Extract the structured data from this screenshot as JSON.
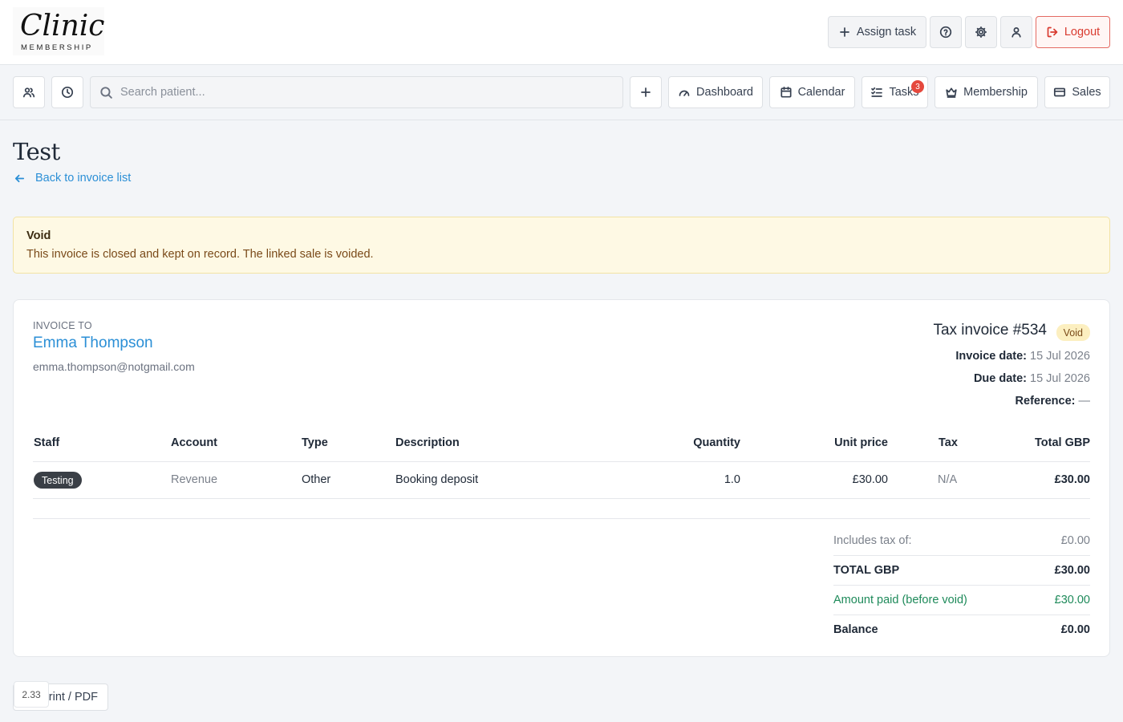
{
  "logo": {
    "script": "Clinic",
    "sub": "MEMBERSHIP"
  },
  "header": {
    "assign_task": "Assign task",
    "logout": "Logout"
  },
  "nav": {
    "search_placeholder": "Search patient...",
    "dashboard": "Dashboard",
    "calendar": "Calendar",
    "tasks": "Tasks",
    "tasks_badge": "3",
    "membership": "Membership",
    "sales": "Sales"
  },
  "page": {
    "title": "Test",
    "back_link": "Back to invoice list"
  },
  "alert": {
    "title": "Void",
    "text": "This invoice is closed and kept on record. The linked sale is voided."
  },
  "invoice": {
    "to_label": "INVOICE TO",
    "client_name": "Emma Thompson",
    "client_email": "emma.thompson@notgmail.com",
    "title": "Tax invoice #534",
    "status": "Void",
    "invoice_date_label": "Invoice date:",
    "invoice_date": "15 Jul 2026",
    "due_date_label": "Due date:",
    "due_date": "15 Jul 2026",
    "reference_label": "Reference:",
    "reference": "—"
  },
  "table": {
    "headers": {
      "staff": "Staff",
      "account": "Account",
      "type": "Type",
      "description": "Description",
      "quantity": "Quantity",
      "unit_price": "Unit price",
      "tax": "Tax",
      "total": "Total GBP"
    },
    "rows": [
      {
        "staff": "Testing",
        "account": "Revenue",
        "type": "Other",
        "description": "Booking deposit",
        "quantity": "1.0",
        "unit_price": "£30.00",
        "tax": "N/A",
        "total": "£30.00"
      }
    ]
  },
  "totals": {
    "includes_tax_label": "Includes tax of:",
    "includes_tax": "£0.00",
    "total_label": "TOTAL GBP",
    "total": "£30.00",
    "paid_label": "Amount paid (before void)",
    "paid": "£30.00",
    "balance_label": "Balance",
    "balance": "£0.00"
  },
  "footer": {
    "print_label": "Print / PDF",
    "version": "2.33"
  },
  "colors": {
    "link": "#2b8fd6",
    "logout": "#d93b30",
    "alert_bg": "#fef9e4",
    "paid_green": "#1e8a5a",
    "badge_red": "#e5483c"
  }
}
